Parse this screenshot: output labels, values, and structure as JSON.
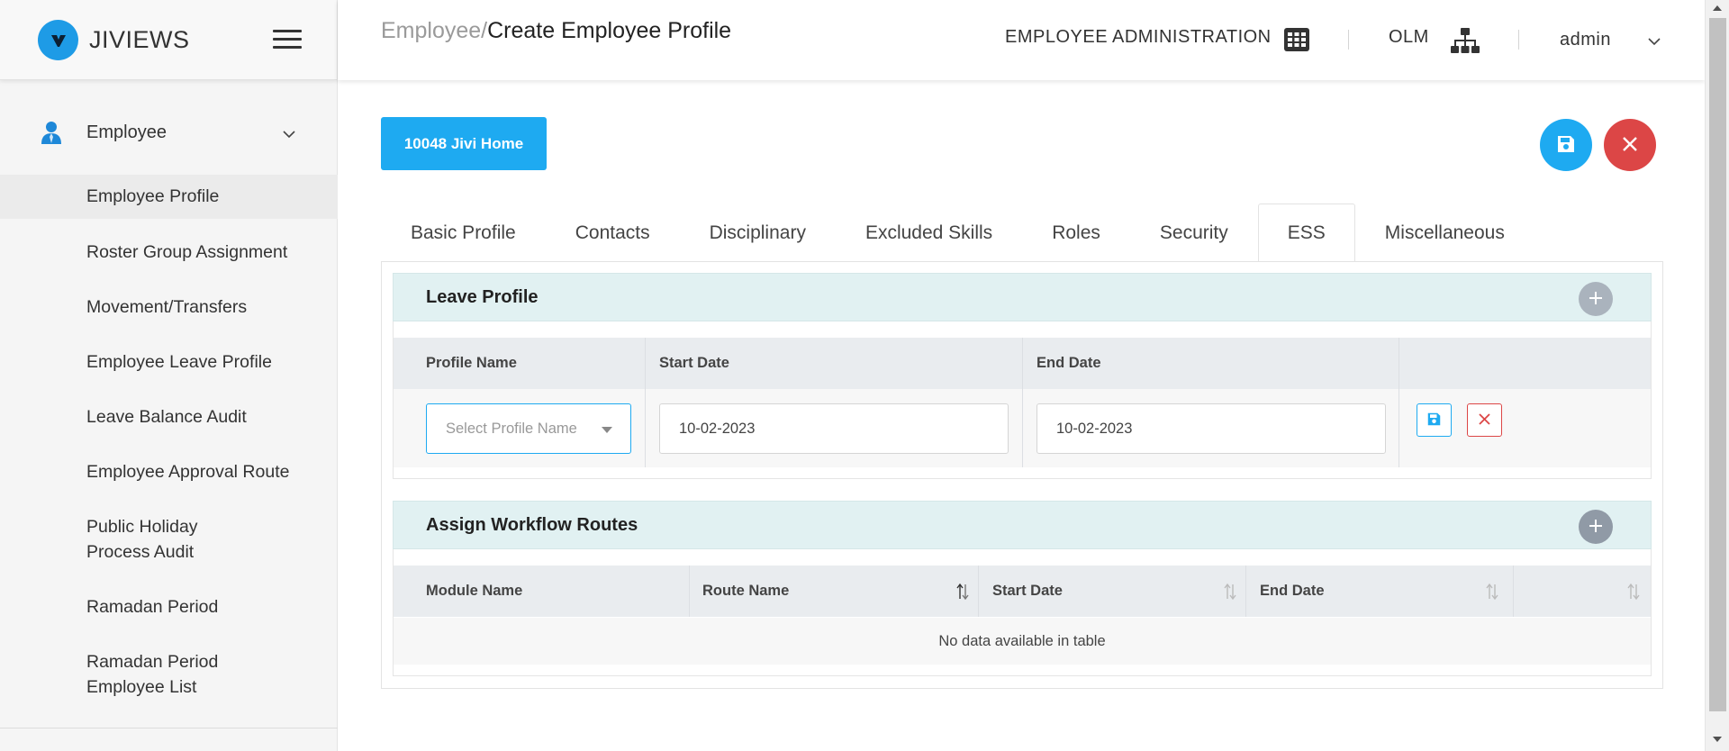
{
  "app": {
    "name": "JIVIEWS"
  },
  "sidebar": {
    "group_label": "Employee",
    "items": [
      {
        "label": "Employee Profile",
        "active": true
      },
      {
        "label": "Roster Group Assignment"
      },
      {
        "label": "Movement/Transfers"
      },
      {
        "label": "Employee Leave Profile"
      },
      {
        "label": "Leave Balance Audit"
      },
      {
        "label": "Employee Approval Route"
      },
      {
        "label": "Public Holiday Process Audit"
      },
      {
        "label": "Ramadan Period"
      },
      {
        "label": "Ramadan Period Employee List"
      }
    ]
  },
  "header": {
    "breadcrumb_parent": "Employee",
    "breadcrumb_sep": "/",
    "breadcrumb_current": "Create Employee Profile",
    "menu_admin": "EMPLOYEE ADMINISTRATION",
    "menu_olm": "OLM",
    "user": "admin"
  },
  "employee_button": "10048 Jivi Home",
  "tabs": [
    {
      "label": "Basic Profile"
    },
    {
      "label": "Contacts"
    },
    {
      "label": "Disciplinary"
    },
    {
      "label": "Excluded Skills"
    },
    {
      "label": "Roles"
    },
    {
      "label": "Security"
    },
    {
      "label": "ESS",
      "active": true
    },
    {
      "label": "Miscellaneous"
    }
  ],
  "leave_profile": {
    "title": "Leave Profile",
    "columns": [
      "Profile Name",
      "Start Date",
      "End Date"
    ],
    "row": {
      "profile_placeholder": "Select Profile Name",
      "start_date": "10-02-2023",
      "end_date": "10-02-2023"
    }
  },
  "workflow_routes": {
    "title": "Assign Workflow Routes",
    "columns": [
      "Module Name",
      "Route Name",
      "Start Date",
      "End Date"
    ],
    "empty_text": "No data available in table"
  },
  "colors": {
    "primary": "#1eaaf1",
    "danger": "#dc4646",
    "section_header_bg": "#e1f1f2"
  }
}
